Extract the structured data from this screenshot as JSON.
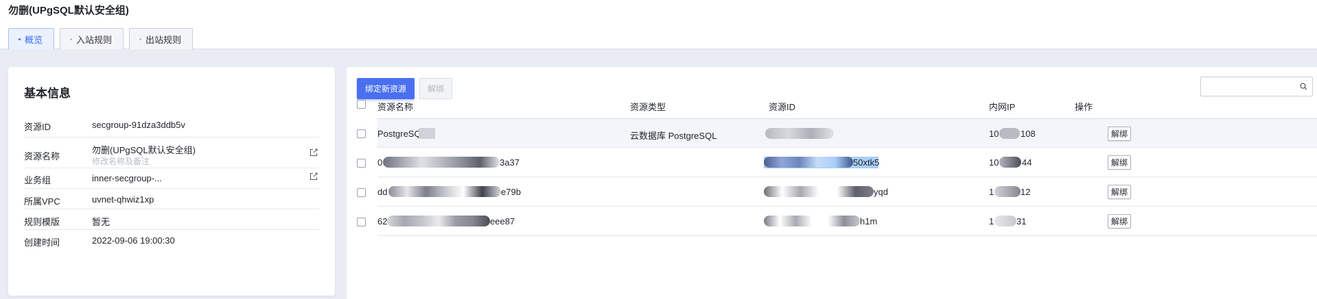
{
  "page": {
    "title": "勿删(UPgSQL默认安全组)"
  },
  "tabs": [
    {
      "label": "概览",
      "active": true
    },
    {
      "label": "入站规则",
      "active": false
    },
    {
      "label": "出站规则",
      "active": false
    }
  ],
  "info": {
    "title": "基本信息",
    "rows": [
      {
        "label": "资源ID",
        "value": "secgroup-91dza3ddb5v"
      },
      {
        "label": "资源名称",
        "value": "勿删(UPgSQL默认安全组)",
        "hint": "修改名称及备注"
      },
      {
        "label": "业务组",
        "value": "inner-secgroup-..."
      },
      {
        "label": "所属VPC",
        "value": "uvnet-qhwiz1xp"
      },
      {
        "label": "规则模版",
        "value": "暂无"
      },
      {
        "label": "创建时间",
        "value": "2022-09-06 19:00:30"
      }
    ]
  },
  "toolbar": {
    "bind_label": "绑定新资源",
    "unbind_label": "解绑",
    "search_placeholder": ""
  },
  "table": {
    "columns": [
      "资源名称",
      "资源类型",
      "资源ID",
      "内网IP",
      "操作"
    ],
    "rows": [
      {
        "name_prefix": "PostgreSQ",
        "name_suffix": "",
        "type": "云数据库 PostgreSQL",
        "id_suffix": "",
        "ip_prefix": "10",
        "ip_suffix": "108",
        "action": "解绑"
      },
      {
        "name_prefix": "0",
        "name_suffix": "3a37",
        "type": "",
        "id_suffix": "50xtk5",
        "ip_prefix": "10",
        "ip_suffix": "44",
        "action": "解绑"
      },
      {
        "name_prefix": "dd",
        "name_suffix": "e79b",
        "type": "",
        "id_suffix": "yqd",
        "ip_prefix": "1",
        "ip_suffix": "12",
        "action": "解绑"
      },
      {
        "name_prefix": "62",
        "name_suffix": "eee87",
        "type": "",
        "id_suffix": "h1m",
        "ip_prefix": "1",
        "ip_suffix": "31",
        "action": "解绑"
      }
    ]
  },
  "colors": {
    "accent": "#4a70f0",
    "border": "#d9dde6",
    "background": "#e9ecf3"
  }
}
